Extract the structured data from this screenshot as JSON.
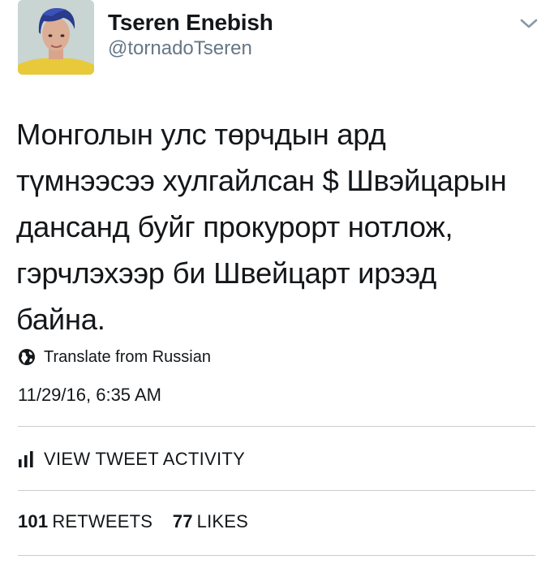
{
  "user": {
    "display_name": "Tseren Enebish",
    "handle": "@tornadoTseren"
  },
  "tweet": {
    "lines": [
      "Монголын улс төрчдын ард",
      "түмнээсээ хулгайлсан $ Швэйцарын",
      "дансанд буйг прокурорт нотлож,",
      "гэрчлэхээр би Швейцарт ирээд",
      "байна."
    ],
    "translate_label": "Translate from Russian",
    "timestamp": "11/29/16, 6:35 AM"
  },
  "activity": {
    "label": "VIEW TWEET ACTIVITY"
  },
  "stats": {
    "retweets_count": "101",
    "retweets_label": "RETWEETS",
    "likes_count": "77",
    "likes_label": "LIKES"
  },
  "icons": {
    "menu": "chevron-down-icon",
    "translate": "globe-icon",
    "activity": "bar-chart-icon"
  },
  "colors": {
    "text": "#14171a",
    "secondary": "#657786",
    "divider": "#c8cdd1"
  }
}
